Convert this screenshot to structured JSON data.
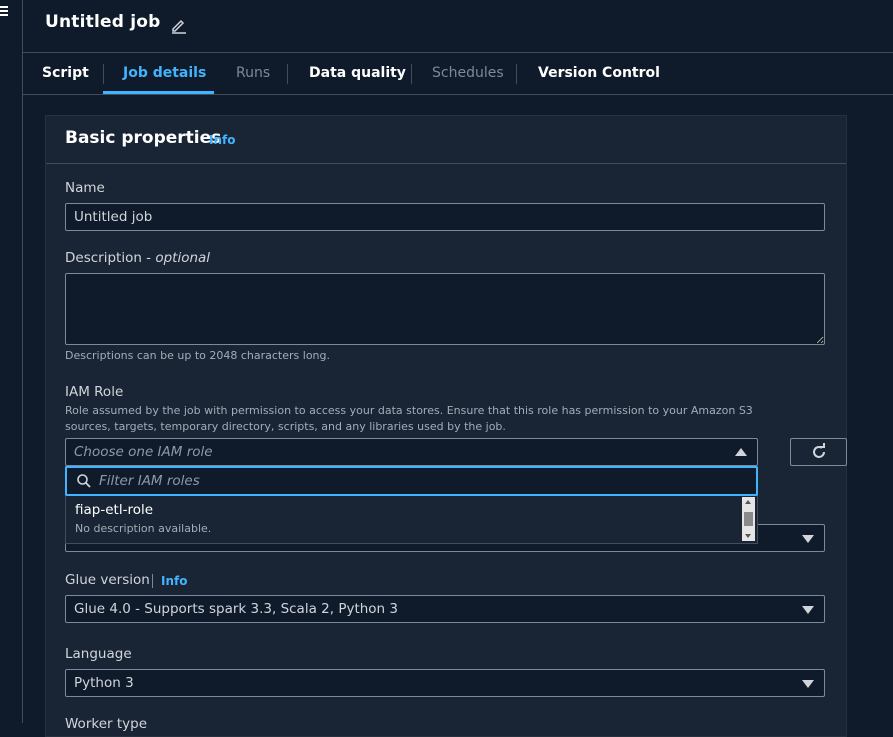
{
  "header": {
    "title": "Untitled job"
  },
  "tabs": [
    {
      "label": "Script",
      "state": "normal"
    },
    {
      "label": "Job details",
      "state": "active"
    },
    {
      "label": "Runs",
      "state": "disabled"
    },
    {
      "label": "Data quality",
      "state": "normal"
    },
    {
      "label": "Schedules",
      "state": "disabled"
    },
    {
      "label": "Version Control",
      "state": "normal"
    }
  ],
  "panel": {
    "title": "Basic properties",
    "info": "Info",
    "name": {
      "label": "Name",
      "value": "Untitled job"
    },
    "description": {
      "label": "Description - ",
      "label_optional": "optional",
      "value": "",
      "hint": "Descriptions can be up to 2048 characters long."
    },
    "iam_role": {
      "label": "IAM Role",
      "hint": "Role assumed by the job with permission to access your data stores. Ensure that this role has permission to your Amazon S3 sources, targets, temporary directory, scripts, and any libraries used by the job.",
      "placeholder": "Choose one IAM role",
      "filter_placeholder": "Filter IAM roles",
      "options": [
        {
          "title": "fiap-etl-role",
          "desc": "No description available."
        }
      ]
    },
    "glue_version": {
      "label": "Glue version",
      "info": "Info",
      "value": "Glue 4.0 - Supports spark 3.3, Scala 2, Python 3"
    },
    "language": {
      "label": "Language",
      "value": "Python 3"
    },
    "partial_next_label": "Worker type"
  },
  "colors": {
    "accent": "#42b4ff",
    "background": "#0f1b2a",
    "panel": "#192534",
    "border": "#7d8998"
  }
}
